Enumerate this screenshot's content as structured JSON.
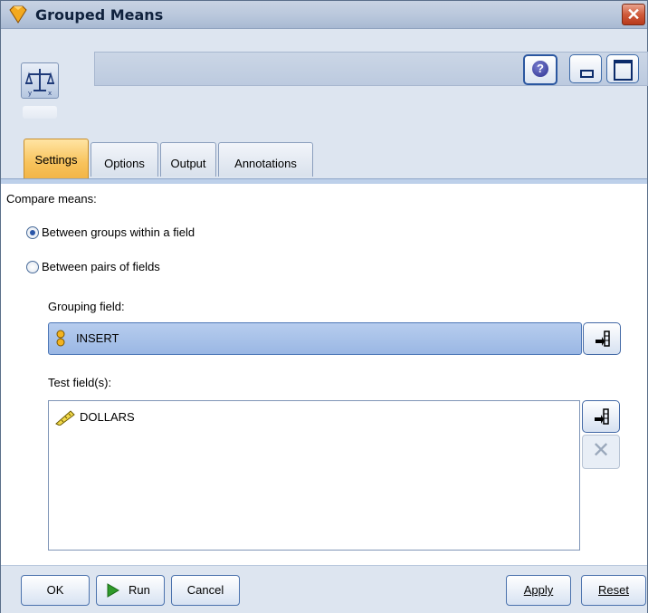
{
  "window": {
    "title": "Grouped Means"
  },
  "header": {
    "node_name": ""
  },
  "tabs": [
    {
      "label": "Settings",
      "active": true
    },
    {
      "label": "Options",
      "active": false
    },
    {
      "label": "Output",
      "active": false
    },
    {
      "label": "Annotations",
      "active": false
    }
  ],
  "settings": {
    "compare_label": "Compare means:",
    "options": [
      {
        "label": "Between groups within a field",
        "selected": true
      },
      {
        "label": "Between pairs of fields",
        "selected": false
      }
    ],
    "grouping_field_label": "Grouping field:",
    "grouping_field_value": "INSERT",
    "test_fields_label": "Test field(s):",
    "test_fields": [
      "DOLLARS"
    ]
  },
  "footer": {
    "ok": "OK",
    "run": "Run",
    "cancel": "Cancel",
    "apply": "Apply",
    "reset": "Reset"
  },
  "colors": {
    "active_tab": "#f8c35c",
    "selection": "#9ab7e4",
    "accent": "#2a56a8"
  }
}
